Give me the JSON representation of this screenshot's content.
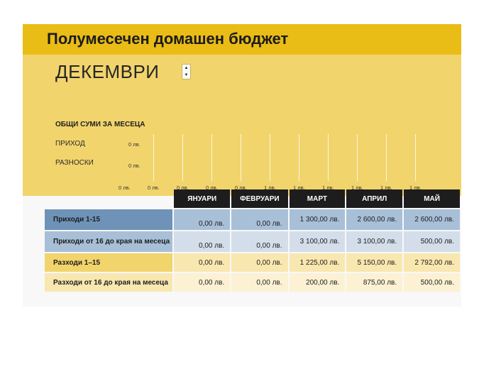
{
  "title": "Полумесечен домашен бюджет",
  "month": "ДЕКЕМВРИ",
  "spinner": {
    "up": "▲",
    "down": "▼"
  },
  "totals": {
    "title": "ОБЩИ СУМИ ЗА МЕСЕЦА",
    "income_label": "ПРИХОД",
    "expense_label": "РАЗНОСКИ",
    "income_value": "0 лв.",
    "expense_value": "0 лв.",
    "axis": [
      "0 лв.",
      "0 лв.",
      "0 лв.",
      "0 лв.",
      "0 лв.",
      "1 лв.",
      "1 лв.",
      "1 лв.",
      "1 лв.",
      "1 лв.",
      "1 лв."
    ]
  },
  "table": {
    "columns": [
      "ЯНУАРИ",
      "ФЕВРУАРИ",
      "МАРТ",
      "АПРИЛ",
      "МАЙ"
    ],
    "rows": [
      {
        "label": "Приходи 1-15",
        "values": [
          "0,00 лв.",
          "0,00 лв.",
          "1 300,00 лв.",
          "2 600,00 лв.",
          "2 600,00 лв."
        ]
      },
      {
        "label": "Приходи от 16 до края на месеца",
        "values": [
          "0,00 лв.",
          "0,00 лв.",
          "3 100,00 лв.",
          "3 100,00 лв.",
          "500,00 лв."
        ]
      },
      {
        "label": "Разходи 1–15",
        "values": [
          "0,00 лв.",
          "0,00 лв.",
          "1 225,00 лв.",
          "5 150,00 лв.",
          "2 792,00 лв."
        ]
      },
      {
        "label": "Разходи от 16 до края на месеца",
        "values": [
          "0,00 лв.",
          "0,00 лв.",
          "200,00 лв.",
          "875,00 лв.",
          "500,00 лв."
        ]
      }
    ]
  },
  "colors": {
    "title_band": "#eabc16",
    "top_band": "#f2d46c",
    "income_label_1": "#6f92b8",
    "income_label_2": "#a8bfd8",
    "expense_label_1": "#f2d46c",
    "expense_label_2": "#f9e7b0",
    "header": "#1d1d1d"
  }
}
